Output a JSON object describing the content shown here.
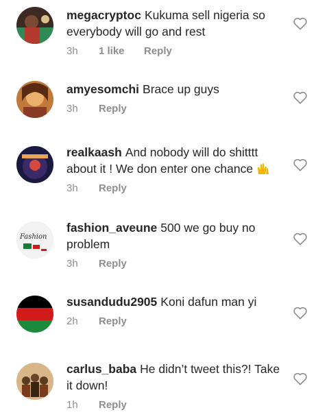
{
  "comments": [
    {
      "username": "megacryptoc",
      "text": "Kukuma sell nigeria so everybody will go and rest",
      "time": "3h",
      "likes": "1 like",
      "reply": "Reply",
      "avatar": "avatar-megacryptoc",
      "colors": {
        "bg": "#3d2a22",
        "accent": "#2e8b57"
      }
    },
    {
      "username": "amyesomchi",
      "text": "Brace up guys",
      "time": "3h",
      "likes": "",
      "reply": "Reply",
      "avatar": "avatar-amyesomchi",
      "colors": {
        "bg": "#c27a3c",
        "accent": "#e9b16c"
      }
    },
    {
      "username": "realkaash",
      "text": "And nobody will do shitttt about it ! We don enter one chance",
      "emoji": "raising-hands-emoji",
      "time": "3h",
      "likes": "",
      "reply": "Reply",
      "avatar": "avatar-realkaash",
      "colors": {
        "bg": "#1a1a40",
        "accent": "#d6493c"
      }
    },
    {
      "username": "fashion_aveune",
      "text": "500 we go buy no problem",
      "time": "3h",
      "likes": "",
      "reply": "Reply",
      "avatar": "avatar-fashion-aveune",
      "avatar_text": "Fashion",
      "colors": {
        "bg": "#f3f3f3",
        "accent": "#1a7a3a"
      }
    },
    {
      "username": "susandudu2905",
      "text": "Koni dafun man yi",
      "time": "2h",
      "likes": "",
      "reply": "Reply",
      "avatar": "avatar-susandudu2905",
      "colors": {
        "top": "#000000",
        "mid": "#d11b1b",
        "bottom": "#1c8a3c"
      }
    },
    {
      "username": "carlus_baba",
      "text": "He didn’t tweet this?! Take it down!",
      "time": "1h",
      "likes": "",
      "reply": "Reply",
      "avatar": "avatar-carlus-baba",
      "colors": {
        "bg": "#d9b58a",
        "accent": "#5a3b22"
      }
    }
  ],
  "icons": {
    "like": "heart-outline-icon"
  }
}
